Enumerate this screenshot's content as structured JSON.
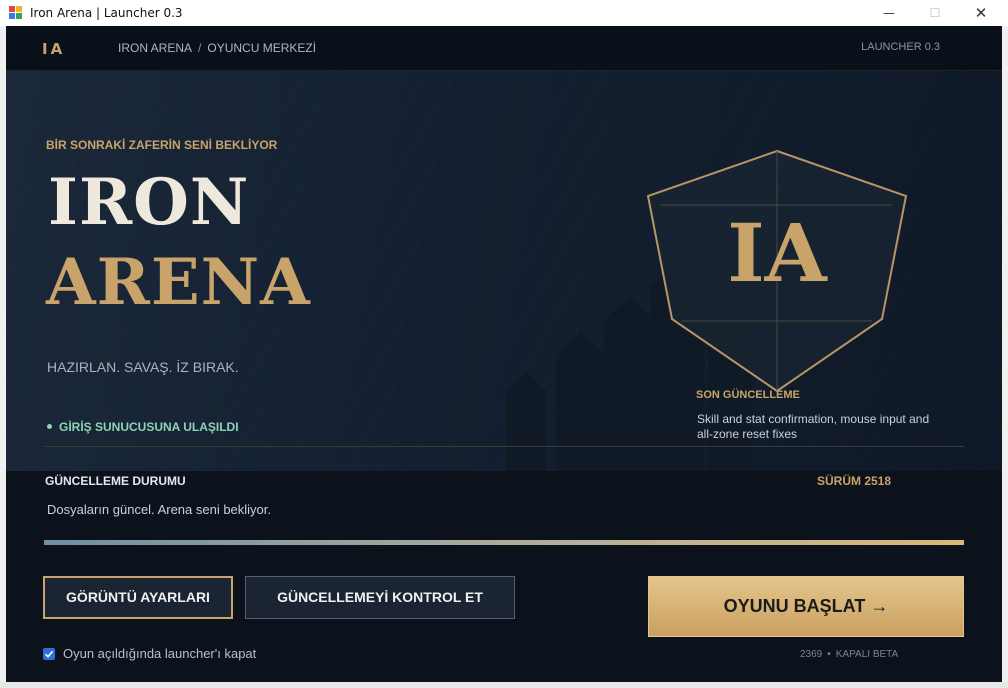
{
  "window": {
    "title": "Iron Arena | Launcher 0.3",
    "controls": {
      "minimize": "—",
      "maximize": "☐",
      "close": "✕"
    }
  },
  "nav": {
    "logo": "IA",
    "breadcrumb": [
      "IRON ARENA",
      "OYUNCU MERKEZİ"
    ],
    "breadcrumb_sep": "/",
    "version": "LAUNCHER 0.3"
  },
  "hero": {
    "tagline": "BİR SONRAKİ ZAFERİN SENİ BEKLİYOR",
    "title_line1": "IRON",
    "title_line2": "ARENA",
    "slogan": "HAZIRLAN. SAVAŞ. İZ BIRAK.",
    "server_status": "GİRİŞ SUNUCUSUNA ULAŞILDI",
    "emblem_monogram": "IA",
    "last_update_title": "SON GÜNCELLEME",
    "last_update_text": "Skill and stat confirmation, mouse input and all-zone reset fixes"
  },
  "status": {
    "title": "GÜNCELLEME DURUMU",
    "version_label": "SÜRÜM 2518",
    "message": "Dosyaların güncel. Arena seni bekliyor.",
    "progress": 1.0
  },
  "actions": {
    "display_settings": "GÖRÜNTÜ AYARLARI",
    "check_update": "GÜNCELLEMEYİ KONTROL ET",
    "play": "OYUNU BAŞLAT →"
  },
  "footer": {
    "close_on_launch_label": "Oyun açıldığında launcher'ı kapat",
    "close_on_launch_checked": true,
    "build": "2369",
    "separator": "•",
    "channel": "KAPALI BETA"
  },
  "colors": {
    "accent_gold": "#c8a36a",
    "background": "#0b121c",
    "status_green": "#8fd3b6",
    "checkbox_blue": "#2f6fd6"
  }
}
